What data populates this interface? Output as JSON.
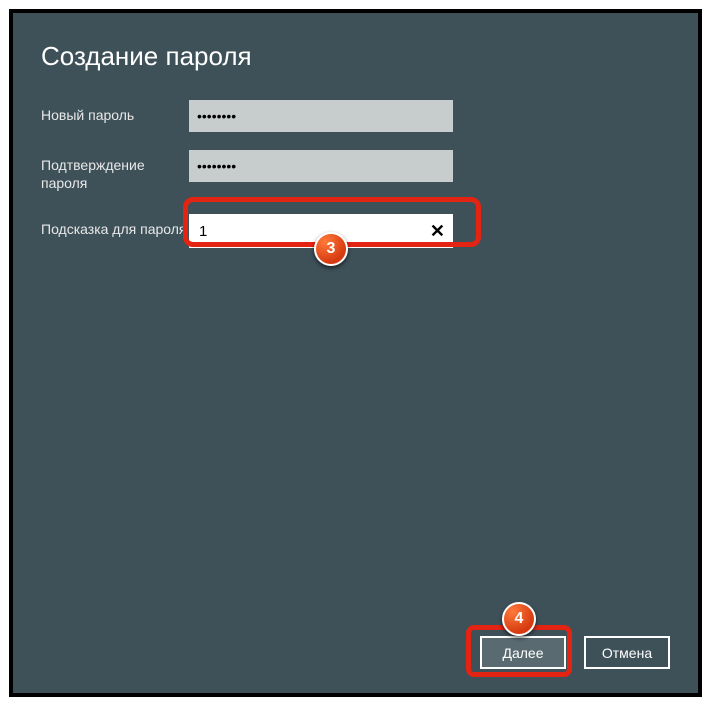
{
  "title": "Создание пароля",
  "fields": {
    "password": {
      "label": "Новый пароль",
      "value": "••••••••"
    },
    "confirm": {
      "label": "Подтверждение пароля",
      "value": "••••••••"
    },
    "hint": {
      "label": "Подсказка для пароля",
      "value": "1"
    }
  },
  "buttons": {
    "next": "Далее",
    "cancel": "Отмена"
  },
  "annotations": {
    "step3": "3",
    "step4": "4"
  }
}
